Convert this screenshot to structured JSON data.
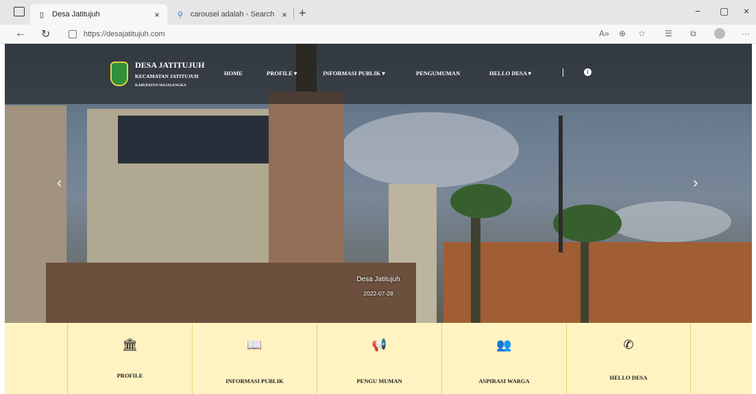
{
  "browser": {
    "tabs": [
      {
        "title": "Desa Jatitujuh",
        "close": "×"
      },
      {
        "title": "carousel adalah - Search",
        "close": "×"
      }
    ],
    "new_tab": "+",
    "window_controls": {
      "minimize": "−",
      "maximize": "▢",
      "close": "×"
    },
    "url": "https://desajatitujuh.com",
    "toolbar_icons": [
      "read-aloud-icon",
      "zoom-icon",
      "favorite-add-icon",
      "favorites-icon",
      "collections-icon",
      "profile-icon",
      "more-icon"
    ],
    "more": "···"
  },
  "site": {
    "brand": {
      "name": "DESA JATITUJUH",
      "sub": "KECAMATAN JATITUJUH",
      "sub2": "KABUPATEN MAJALENGKA"
    },
    "menu": [
      {
        "label": "HOME"
      },
      {
        "label": "PROFILE ▾"
      },
      {
        "label": "INFORMASI PUBLIK ▾"
      },
      {
        "label": "PENGUMUMAN"
      },
      {
        "label": "HELLO DESA ▾"
      }
    ],
    "divider": "|",
    "carousel": {
      "prev": "‹",
      "next": "›",
      "caption_title": "Desa Jatitujuh",
      "caption_date": "2022-07-28"
    },
    "features": [
      {
        "label": "PROFILE",
        "icon": "🏛"
      },
      {
        "label": "INFORMASI PUBLIK",
        "icon": "📖"
      },
      {
        "label": "PENGU MUMAN",
        "icon": "📢"
      },
      {
        "label": "ASPIRASI WARGA",
        "icon": "👥"
      },
      {
        "label": "HELLO DESA",
        "icon": "✆"
      }
    ]
  }
}
